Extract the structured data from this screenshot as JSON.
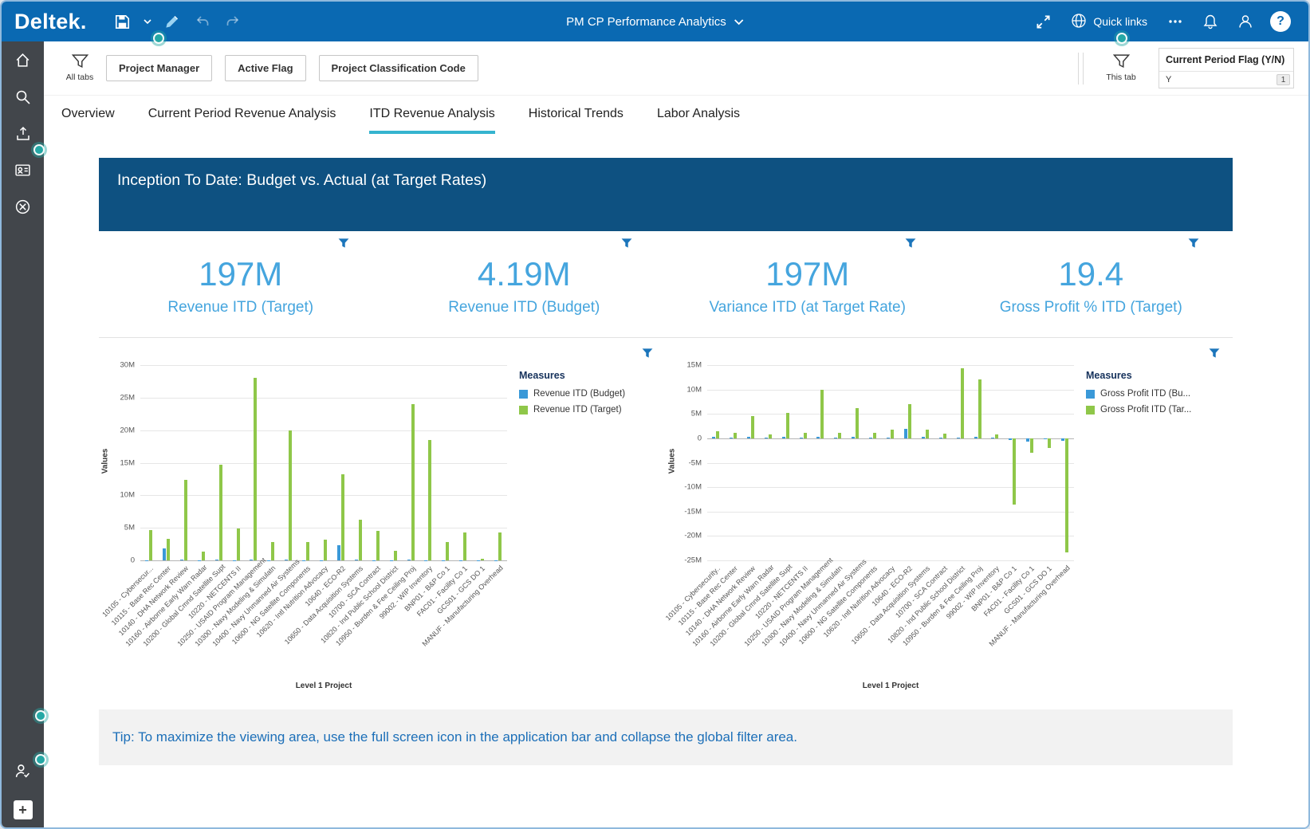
{
  "topbar": {
    "logo": "Deltek.",
    "title": "PM CP Performance Analytics",
    "quick_links_label": "Quick links"
  },
  "filter_bar": {
    "all_tabs_label": "All tabs",
    "this_tab_label": "This tab",
    "filter_buttons": [
      "Project Manager",
      "Active Flag",
      "Project Classification Code"
    ],
    "current_period_field": {
      "label": "Current Period Flag (Y/N)",
      "value": "Y",
      "count_badge": "1"
    }
  },
  "tabs": [
    {
      "label": "Overview"
    },
    {
      "label": "Current Period Revenue Analysis"
    },
    {
      "label": "ITD Revenue Analysis"
    },
    {
      "label": "Historical Trends"
    },
    {
      "label": "Labor Analysis"
    }
  ],
  "active_tab": "ITD Revenue Analysis",
  "banner_title": "Inception To Date:  Budget vs. Actual (at Target Rates)",
  "kpis": [
    {
      "value": "197M",
      "label": "Revenue ITD (Target)"
    },
    {
      "value": "4.19M",
      "label": "Revenue ITD (Budget)"
    },
    {
      "value": "197M",
      "label": "Variance ITD (at Target Rate)"
    },
    {
      "value": "19.4",
      "label": "Gross Profit % ITD (Target)"
    }
  ],
  "tip_text": "Tip:  To maximize the viewing area, use the full screen icon in the application bar and collapse the global filter area.",
  "colors": {
    "topbar_blue": "#0a69b2",
    "banner_navy": "#0e5181",
    "kpi_blue": "#45a5de",
    "active_tab_teal": "#35b4cf",
    "bar_green": "#8fc749",
    "bar_blue": "#3a99d8",
    "funnel_blue": "#1b75bb",
    "sidebar_gray": "#42464b",
    "guide_dot_teal": "#25a8a5"
  },
  "icons": [
    "save-icon",
    "edit-icon",
    "undo-icon",
    "redo-icon",
    "chevron-down-icon",
    "fullscreen-icon",
    "globe-icon",
    "more-options-icon",
    "bell-icon",
    "person-icon",
    "help-icon",
    "home-icon",
    "search-icon",
    "export-icon",
    "contacts-icon",
    "navigate-icon",
    "user-check-icon",
    "plus-icon",
    "filter-funnel-icon"
  ],
  "chart_data": [
    {
      "type": "bar",
      "title": "",
      "xlabel": "Level 1 Project",
      "ylabel": "Values",
      "unit": "M",
      "ylim": [
        0,
        30
      ],
      "ytick_step": 5,
      "grid": true,
      "legend_title": "Measures",
      "legend_position": "right",
      "categories": [
        "10105 - Cybersecur...",
        "10115 - Base Rec Center",
        "10140 - DHA Network Review",
        "10160 - Airborne Early Warn Radar",
        "10200 - Global Cmnd Satellite Supt",
        "10220 - NETCENTS II",
        "10250 - USAID Program Management",
        "10300 - Navy Modeling & Simulatn",
        "10400 - Navy Unmanned Air Systems",
        "10600 - NG Satellite Components",
        "10620 - Intl Nutrition Advocacy",
        "10640 - ECO-R2",
        "10650 - Data Acquisition Systems",
        "10700 - SCA Contract",
        "10820 - Ind Public School District",
        "10950 - Burden & Fee Ceiling Proj",
        "99002 - WIP Inventory",
        "BNP01 - B&P Co 1",
        "FAC01 - Facility Co 1",
        "GCS01 - GCS DO 1",
        "MANUF - Manufacturing Overhead"
      ],
      "series": [
        {
          "name": "Revenue ITD (Budget)",
          "color": "#3a99d8",
          "values": [
            0.05,
            1.9,
            0.1,
            0.05,
            0.1,
            0.05,
            0.1,
            0.05,
            0.1,
            0.05,
            0.05,
            2.3,
            0.1,
            0.05,
            0.05,
            0.1,
            0.05,
            0.05,
            0.05,
            0.02,
            0.05
          ]
        },
        {
          "name": "Revenue ITD (Target)",
          "color": "#8fc749",
          "values": [
            4.6,
            3.3,
            12.4,
            1.4,
            14.7,
            4.9,
            28.1,
            2.8,
            20.0,
            2.8,
            3.2,
            13.2,
            6.3,
            4.5,
            1.5,
            24.0,
            18.5,
            2.8,
            4.3,
            0.2,
            4.3
          ]
        }
      ]
    },
    {
      "type": "bar",
      "title": "",
      "xlabel": "Level 1 Project",
      "ylabel": "Values",
      "unit": "M",
      "ylim": [
        -25,
        15
      ],
      "ytick_step": 5,
      "grid": true,
      "legend_title": "Measures",
      "legend_position": "right",
      "categories": [
        "10105 - Cybersecurity..",
        "10115 - Base Rec Center",
        "10140 - DHA Network Review",
        "10160 - Airborne Early Warn Radar",
        "10200 - Global Cmnd Satellite Supt",
        "10220 - NETCENTS II",
        "10250 - USAID Program Management",
        "10300 - Navy Modeling & Simulatn",
        "10400 - Navy Unmanned Air Systems",
        "10600 - NG Satellite Components",
        "10620 - Intl Nutrition Advocacy",
        "10640 - ECO-R2",
        "10650 - Data Acquisition Systems",
        "10700 - SCA Contract",
        "10820 - Ind Public School District",
        "10950 - Burden & Fee Ceiling Proj",
        "99002 - WIP Inventory",
        "BNP01 - B&P Co 1",
        "FAC01 - Facility Co 1",
        "GCS01 - GCS DO 1",
        "MANUF - Manufacturing Overhead"
      ],
      "series": [
        {
          "name": "Gross Profit ITD (Bu...",
          "color": "#3a99d8",
          "values": [
            0.3,
            0.2,
            0.3,
            0.1,
            0.3,
            0.2,
            0.3,
            0.2,
            0.3,
            0.2,
            0.2,
            2.0,
            0.3,
            0.1,
            0.2,
            0.3,
            0.1,
            -0.4,
            -0.6,
            -0.2,
            -0.5
          ]
        },
        {
          "name": "Gross Profit ITD (Tar...",
          "color": "#8fc749",
          "values": [
            1.5,
            1.2,
            4.6,
            0.8,
            5.2,
            1.2,
            10.0,
            1.2,
            6.2,
            1.2,
            1.8,
            7.0,
            1.8,
            1.0,
            14.3,
            12.0,
            0.8,
            -13.5,
            -3.0,
            -2.0,
            -23.3
          ]
        }
      ]
    }
  ]
}
